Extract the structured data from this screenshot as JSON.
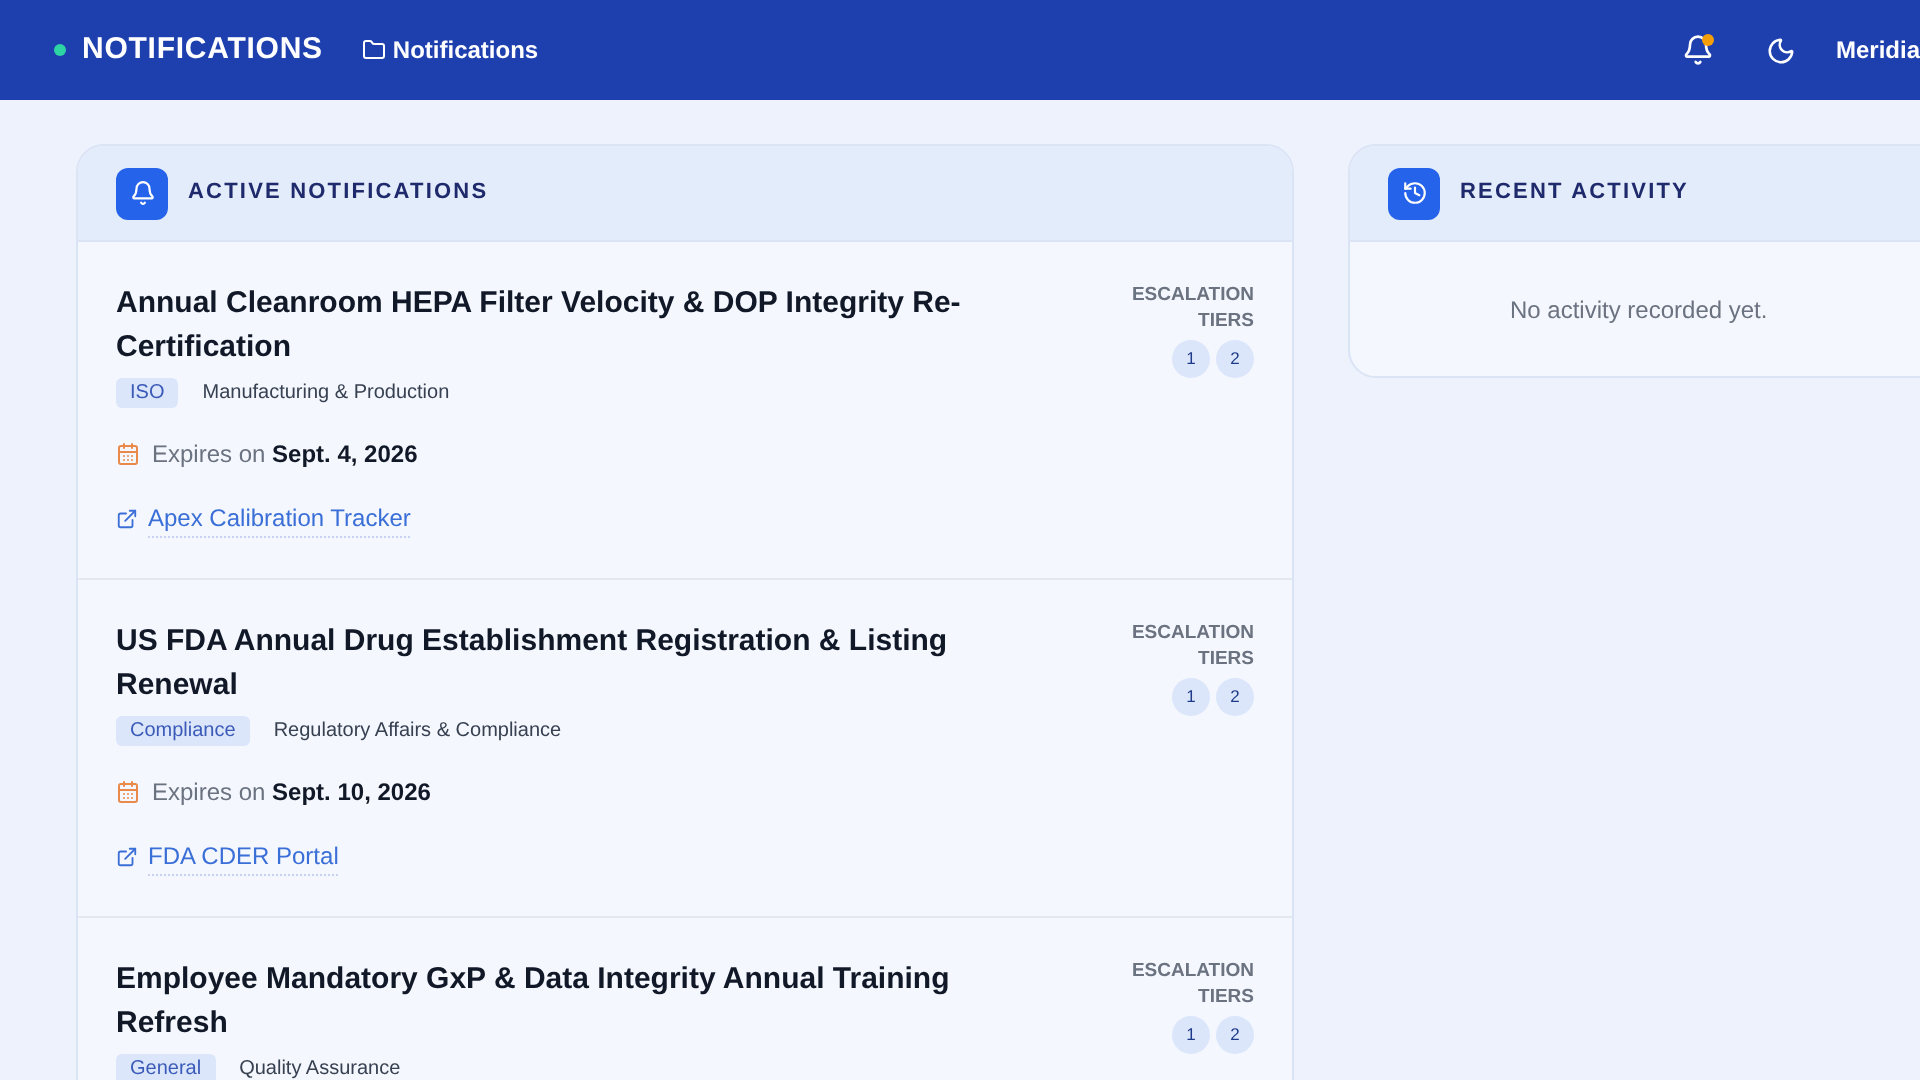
{
  "header": {
    "brand": "NOTIFICATIONS",
    "breadcrumb": "Notifications",
    "has_unread": true,
    "user": "Meridia"
  },
  "active_panel": {
    "title": "ACTIVE NOTIFICATIONS",
    "items": [
      {
        "title": "Annual Cleanroom HEPA Filter Velocity & DOP Integrity Re-Certification",
        "tag": "ISO",
        "department": "Manufacturing & Production",
        "expires_label": "Expires on",
        "expires_date": "Sept. 4, 2026",
        "link": "Apex Calibration Tracker",
        "tiers_label": "ESCALATION TIERS",
        "tiers": [
          "1",
          "2"
        ]
      },
      {
        "title": "US FDA Annual Drug Establishment Registration & Listing Renewal",
        "tag": "Compliance",
        "department": "Regulatory Affairs & Compliance",
        "expires_label": "Expires on",
        "expires_date": "Sept. 10, 2026",
        "link": "FDA CDER Portal",
        "tiers_label": "ESCALATION TIERS",
        "tiers": [
          "1",
          "2"
        ]
      },
      {
        "title": "Employee Mandatory GxP & Data Integrity Annual Training Refresh",
        "tag": "General",
        "department": "Quality Assurance",
        "tiers_label": "ESCALATION TIERS",
        "tiers": [
          "1",
          "2"
        ]
      }
    ]
  },
  "activity_panel": {
    "title": "RECENT ACTIVITY",
    "empty_text": "No activity recorded yet."
  }
}
